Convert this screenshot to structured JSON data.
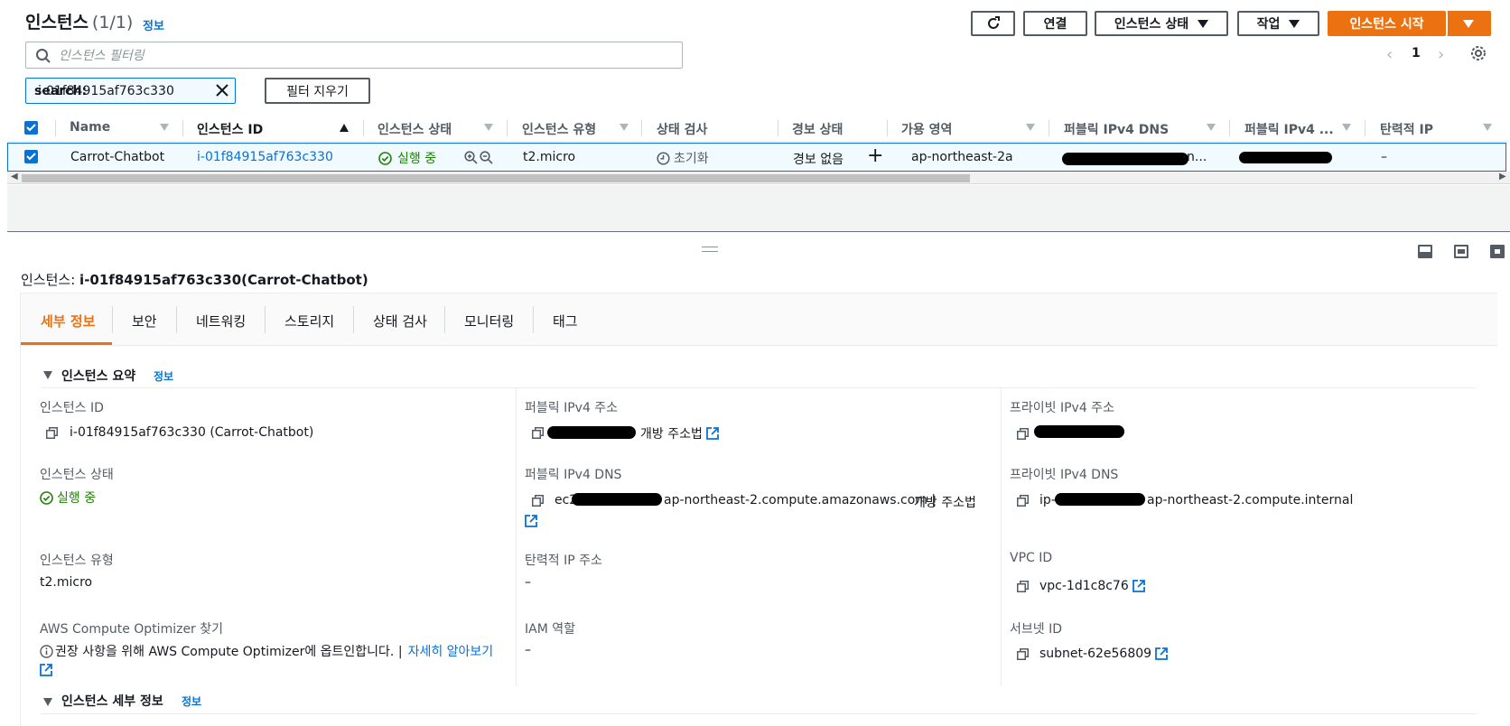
{
  "header": {
    "title": "인스턴스",
    "count": "(1/1)",
    "info": "정보",
    "refresh_icon": "refresh-icon",
    "connect": "연결",
    "instance_state": "인스턴스 상태",
    "actions": "작업",
    "launch": "인스턴스 시작"
  },
  "filter": {
    "placeholder": "인스턴스 필터링",
    "token_key": "search:",
    "token_value": "i-01f84915af763c330",
    "clear": "필터 지우기"
  },
  "pagination": {
    "prev": "‹",
    "page": "1",
    "next": "›"
  },
  "table": {
    "columns": [
      "Name",
      "인스턴스 ID",
      "인스턴스 상태",
      "인스턴스 유형",
      "상태 검사",
      "경보 상태",
      "가용 영역",
      "퍼블릭 IPv4 DNS",
      "퍼블릭 IPv4 ...",
      "탄력적 IP"
    ],
    "row": {
      "name": "Carrot-Chatbot",
      "id": "i-01f84915af763c330",
      "state": "실행 중",
      "type": "t2.micro",
      "check": "초기화",
      "alarm": "경보 없음",
      "plus": "+",
      "az": "ap-northeast-2a",
      "dns_tail": "-n...",
      "elastic": "–"
    }
  },
  "detail": {
    "title_prefix": "인스턴스:",
    "title_value": "i-01f84915af763c330(Carrot-Chatbot)",
    "tabs": [
      "세부 정보",
      "보안",
      "네트워킹",
      "스토리지",
      "상태 검사",
      "모니터링",
      "태그"
    ],
    "summary": {
      "title": "인스턴스 요약",
      "info": "정보",
      "instance_id_label": "인스턴스 ID",
      "instance_id_value": "i-01f84915af763c330 (Carrot-Chatbot)",
      "public_ip_label": "퍼블릭 IPv4 주소",
      "public_ip_link": "개방 주소법",
      "private_ip_label": "프라이빗 IPv4 주소",
      "state_label": "인스턴스 상태",
      "state_value": "실행 중",
      "public_dns_label": "퍼블릭 IPv4 DNS",
      "public_dns_prefix": "ec2",
      "public_dns_suffix": "ap-northeast-2.compute.amazonaws.com |",
      "public_dns_link": "개방 주소법",
      "private_dns_label": "프라이빗 IPv4 DNS",
      "private_dns_prefix": "ip-",
      "private_dns_suffix": "ap-northeast-2.compute.internal",
      "type_label": "인스턴스 유형",
      "type_value": "t2.micro",
      "elastic_label": "탄력적 IP 주소",
      "elastic_value": "–",
      "vpc_label": "VPC ID",
      "vpc_value": "vpc-1d1c8c76",
      "optimizer_label": "AWS Compute Optimizer 찾기",
      "optimizer_text": "권장 사항을 위해 AWS Compute Optimizer에 옵트인합니다. |",
      "optimizer_link": "자세히 알아보기",
      "iam_label": "IAM 역할",
      "iam_value": "–",
      "subnet_label": "서브넷 ID",
      "subnet_value": "subnet-62e56809"
    },
    "details_section": {
      "title": "인스턴스 세부 정보",
      "info": "정보"
    }
  },
  "colors": {
    "primary": "#ec7211",
    "link": "#0972d3",
    "success": "#1d8102"
  }
}
